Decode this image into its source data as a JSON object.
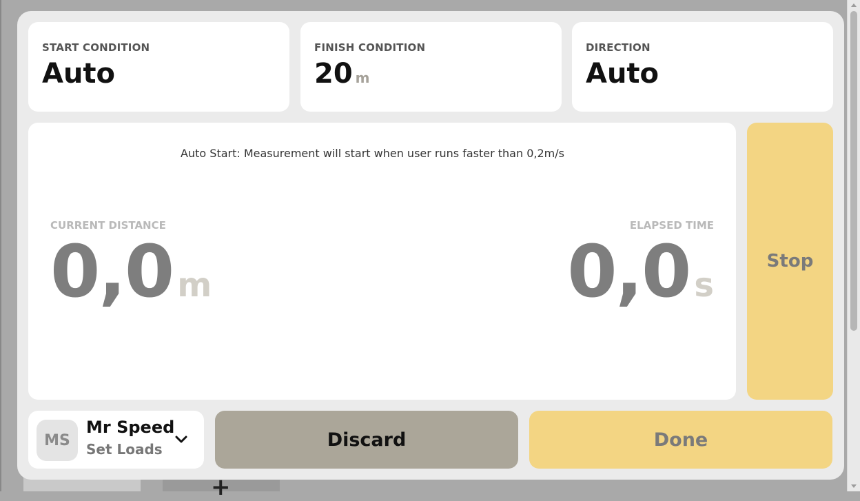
{
  "conditions": {
    "start": {
      "label": "START CONDITION",
      "value": "Auto"
    },
    "finish": {
      "label": "FINISH CONDITION",
      "value": "20",
      "unit": "m"
    },
    "direction": {
      "label": "DIRECTION",
      "value": "Auto"
    }
  },
  "main": {
    "auto_note": "Auto Start: Measurement will start when user runs faster than 0,2m/s",
    "distance": {
      "label": "CURRENT DISTANCE",
      "value": "0,0",
      "unit": "m"
    },
    "time": {
      "label": "ELAPSED TIME",
      "value": "0,0",
      "unit": "s"
    }
  },
  "stop_label": "Stop",
  "user": {
    "initials": "MS",
    "name": "Mr Speed",
    "subtitle": "Set Loads",
    "dropdown_icon": "chevron-down-icon"
  },
  "actions": {
    "discard_label": "Discard",
    "done_label": "Done"
  },
  "background": {
    "plus_glyph": "+"
  },
  "colors": {
    "accent_yellow": "#f3d583",
    "discard_gray": "#aba699",
    "modal_bg": "#ebebeb"
  }
}
